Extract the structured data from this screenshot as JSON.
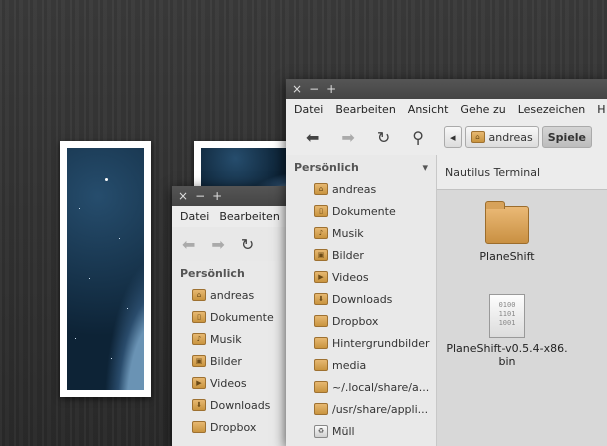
{
  "window_controls": {
    "close": "×",
    "minimize": "−",
    "maximize": "+"
  },
  "back_window": {
    "menu": [
      "Datei",
      "Bearbeiten"
    ],
    "sidebar_heading": "Persönlich",
    "places": [
      "andreas",
      "Dokumente",
      "Musik",
      "Bilder",
      "Videos",
      "Downloads",
      "Dropbox"
    ]
  },
  "front_window": {
    "menu": [
      "Datei",
      "Bearbeiten",
      "Ansicht",
      "Gehe zu",
      "Lesezeichen",
      "H"
    ],
    "toolbar": {
      "back": "back-arrow-icon",
      "forward": "forward-arrow-icon",
      "reload": "reload-icon",
      "search": "search-icon"
    },
    "pathbar": {
      "left_arrow": "◂",
      "home": "andreas",
      "current": "Spiele"
    },
    "sidebar_heading": "Persönlich",
    "places": [
      "andreas",
      "Dokumente",
      "Musik",
      "Bilder",
      "Videos",
      "Downloads",
      "Dropbox",
      "Hintergrundbilder",
      "media",
      "~/.local/share/a...",
      "/usr/share/appli...",
      "Müll"
    ],
    "tab_label": "Nautilus Terminal",
    "files": [
      {
        "name": "PlaneShift",
        "type": "folder"
      },
      {
        "name_line1": "PlaneShift-v0.5.4-x86.",
        "name_line2": "bin",
        "type": "binary",
        "bin_text": [
          "0100",
          "1101",
          "1001"
        ]
      }
    ]
  },
  "colors": {
    "folder": "#d7a25a",
    "titlebar": "#4d4d4d",
    "window_bg": "#ececec"
  }
}
